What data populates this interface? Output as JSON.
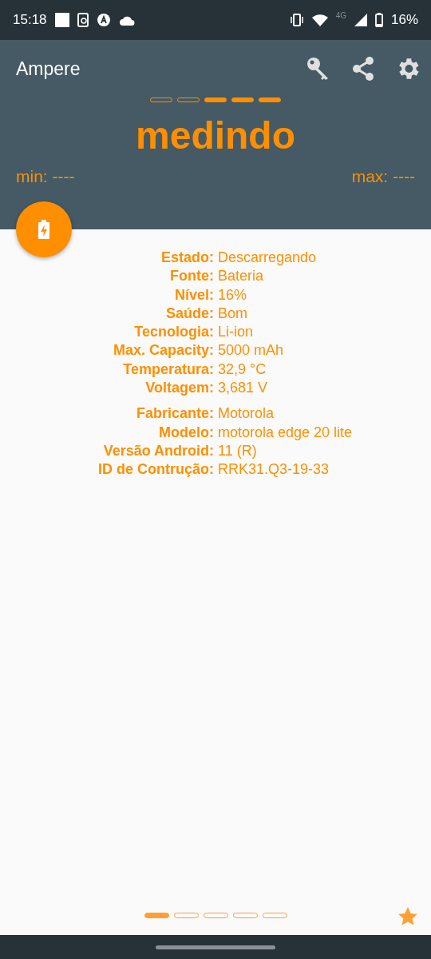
{
  "status_bar": {
    "time": "15:18",
    "network": "4G",
    "battery": "16%"
  },
  "app_bar": {
    "title": "Ampere"
  },
  "meter": {
    "segments": [
      {
        "filled": false
      },
      {
        "filled": false
      },
      {
        "filled": true
      },
      {
        "filled": true
      },
      {
        "filled": true
      }
    ],
    "reading": "medindo",
    "min": "min: ----",
    "max": "max: ----"
  },
  "info_groups": [
    [
      {
        "label": "Estado:",
        "value": "Descarregando"
      },
      {
        "label": "Fonte:",
        "value": "Bateria"
      },
      {
        "label": "Nível:",
        "value": "16%"
      },
      {
        "label": "Saúde:",
        "value": "Bom"
      },
      {
        "label": "Tecnologia:",
        "value": "Li-ion"
      },
      {
        "label": "Max. Capacity:",
        "value": "5000 mAh"
      },
      {
        "label": "Temperatura:",
        "value": "32,9 °C"
      },
      {
        "label": "Voltagem:",
        "value": "3,681 V"
      }
    ],
    [
      {
        "label": "Fabricante:",
        "value": "Motorola"
      },
      {
        "label": "Modelo:",
        "value": "motorola edge 20 lite"
      },
      {
        "label": "Versão Android:",
        "value": "11 (R)"
      },
      {
        "label": "ID de Contrução:",
        "value": "RRK31.Q3-19-33"
      }
    ]
  ],
  "pager": [
    {
      "selected": true
    },
    {
      "selected": false
    },
    {
      "selected": false
    },
    {
      "selected": false
    },
    {
      "selected": false
    }
  ]
}
